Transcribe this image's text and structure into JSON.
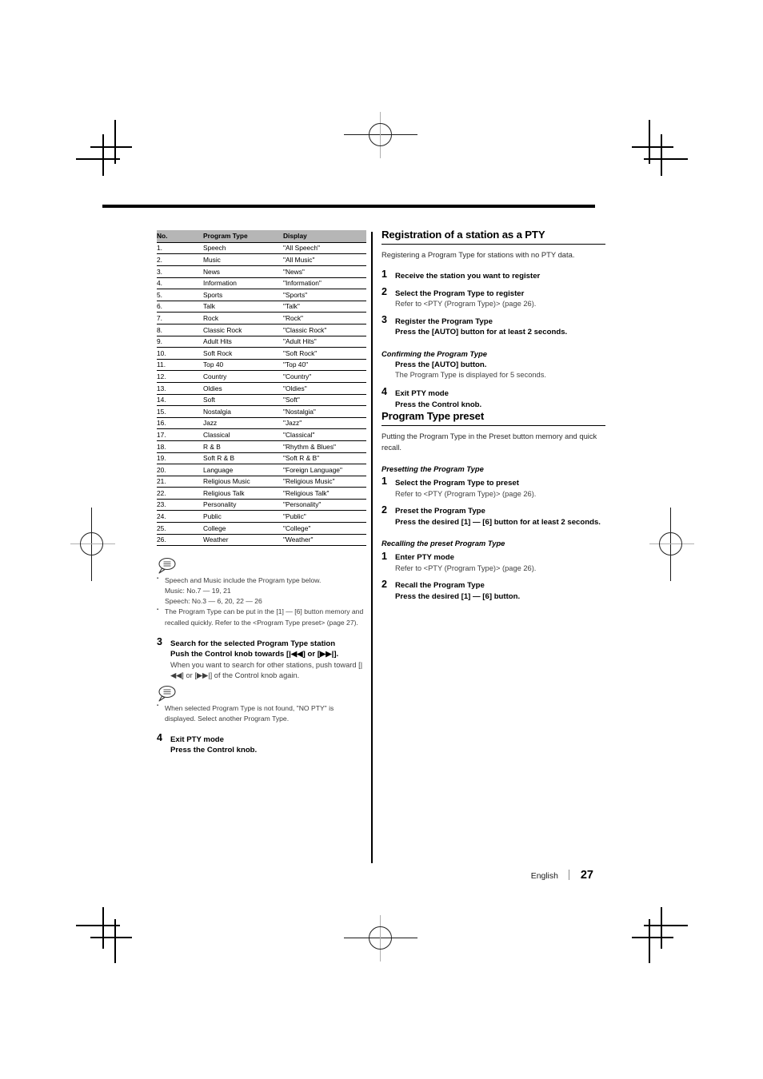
{
  "page": {
    "footer_language": "English",
    "footer_page_number": "27"
  },
  "pty_table": {
    "headers": [
      "No.",
      "Program Type",
      "Display"
    ],
    "rows": [
      [
        "1.",
        "Speech",
        "\"All Speech\""
      ],
      [
        "2.",
        "Music",
        "\"All Music\""
      ],
      [
        "3.",
        "News",
        "\"News\""
      ],
      [
        "4.",
        "Information",
        "\"Information\""
      ],
      [
        "5.",
        "Sports",
        "\"Sports\""
      ],
      [
        "6.",
        "Talk",
        "\"Talk\""
      ],
      [
        "7.",
        "Rock",
        "\"Rock\""
      ],
      [
        "8.",
        "Classic Rock",
        "\"Classic Rock\""
      ],
      [
        "9.",
        "Adult Hits",
        "\"Adult Hits\""
      ],
      [
        "10.",
        "Soft Rock",
        "\"Soft Rock\""
      ],
      [
        "11.",
        "Top 40",
        "\"Top 40\""
      ],
      [
        "12.",
        "Country",
        "\"Country\""
      ],
      [
        "13.",
        "Oldies",
        "\"Oldies\""
      ],
      [
        "14.",
        "Soft",
        "\"Soft\""
      ],
      [
        "15.",
        "Nostalgia",
        "\"Nostalgia\""
      ],
      [
        "16.",
        "Jazz",
        "\"Jazz\""
      ],
      [
        "17.",
        "Classical",
        "\"Classical\""
      ],
      [
        "18.",
        "R & B",
        "\"Rhythm & Blues\""
      ],
      [
        "19.",
        "Soft R & B",
        "\"Soft R & B\""
      ],
      [
        "20.",
        "Language",
        "\"Foreign Language\""
      ],
      [
        "21.",
        "Religious Music",
        "\"Religious Music\""
      ],
      [
        "22.",
        "Religious Talk",
        "\"Religious Talk\""
      ],
      [
        "23.",
        "Personality",
        "\"Personality\""
      ],
      [
        "24.",
        "Public",
        "\"Public\""
      ],
      [
        "25.",
        "College",
        "\"College\""
      ],
      [
        "26.",
        "Weather",
        "\"Weather\""
      ]
    ]
  },
  "note_table": {
    "icon": "note-bubble-icon",
    "bullet1_line1": "Speech and Music include the Program type below.",
    "bullet1_line2": "Music: No.7 — 19, 21",
    "bullet1_line3": "Speech: No.3 — 6, 20, 22 — 26",
    "bullet2": "The Program Type can be put in the [1] — [6] button memory and recalled quickly. Refer to the <Program Type preset> (page 27)."
  },
  "left_steps": {
    "step3": {
      "num": "3",
      "title": "Search for the selected Program Type station",
      "bold_line": "Push the Control knob towards [|◀◀] or [▶▶|].",
      "plain_line": "When you want to search for other stations, push toward [|◀◀] or [▶▶|] of the Control knob again."
    },
    "note2": {
      "icon": "note-bubble-icon",
      "bullet": "When selected Program Type is not found, \"NO PTY\" is displayed. Select another Program Type."
    },
    "step4": {
      "num": "4",
      "title": "Exit PTY mode",
      "bold_line": "Press the Control knob."
    }
  },
  "section_registration": {
    "heading": "Registration of a station as a PTY",
    "intro": "Registering a Program Type for stations with no PTY data.",
    "step1": {
      "num": "1",
      "title": "Receive the station you want to register"
    },
    "step2": {
      "num": "2",
      "title": "Select the Program Type to register",
      "plain_line": "Refer to <PTY (Program Type)> (page 26)."
    },
    "step3": {
      "num": "3",
      "title": "Register the Program Type",
      "bold_line": "Press the [AUTO] button for at least 2 seconds."
    },
    "confirm_subhead": "Confirming the Program Type",
    "confirm_bold": "Press the [AUTO] button.",
    "confirm_plain": "The Program Type is displayed for 5 seconds.",
    "step4": {
      "num": "4",
      "title": "Exit PTY mode",
      "bold_line": "Press the Control knob."
    }
  },
  "section_preset": {
    "heading": "Program Type preset",
    "intro": "Putting the Program Type in the Preset button memory and quick recall.",
    "presetting_subhead": "Presetting the Program Type",
    "preset_step1": {
      "num": "1",
      "title": "Select the Program Type to preset",
      "plain_line": "Refer to <PTY (Program Type)> (page 26)."
    },
    "preset_step2": {
      "num": "2",
      "title": "Preset the Program Type",
      "bold_line": "Press the desired [1] — [6] button for at least 2 seconds."
    },
    "recalling_subhead": "Recalling the preset Program Type",
    "recall_step1": {
      "num": "1",
      "title": "Enter PTY mode",
      "plain_line": "Refer to <PTY (Program Type)> (page 26)."
    },
    "recall_step2": {
      "num": "2",
      "title": "Recall the Program Type",
      "bold_line": "Press the desired [1] — [6] button."
    }
  }
}
